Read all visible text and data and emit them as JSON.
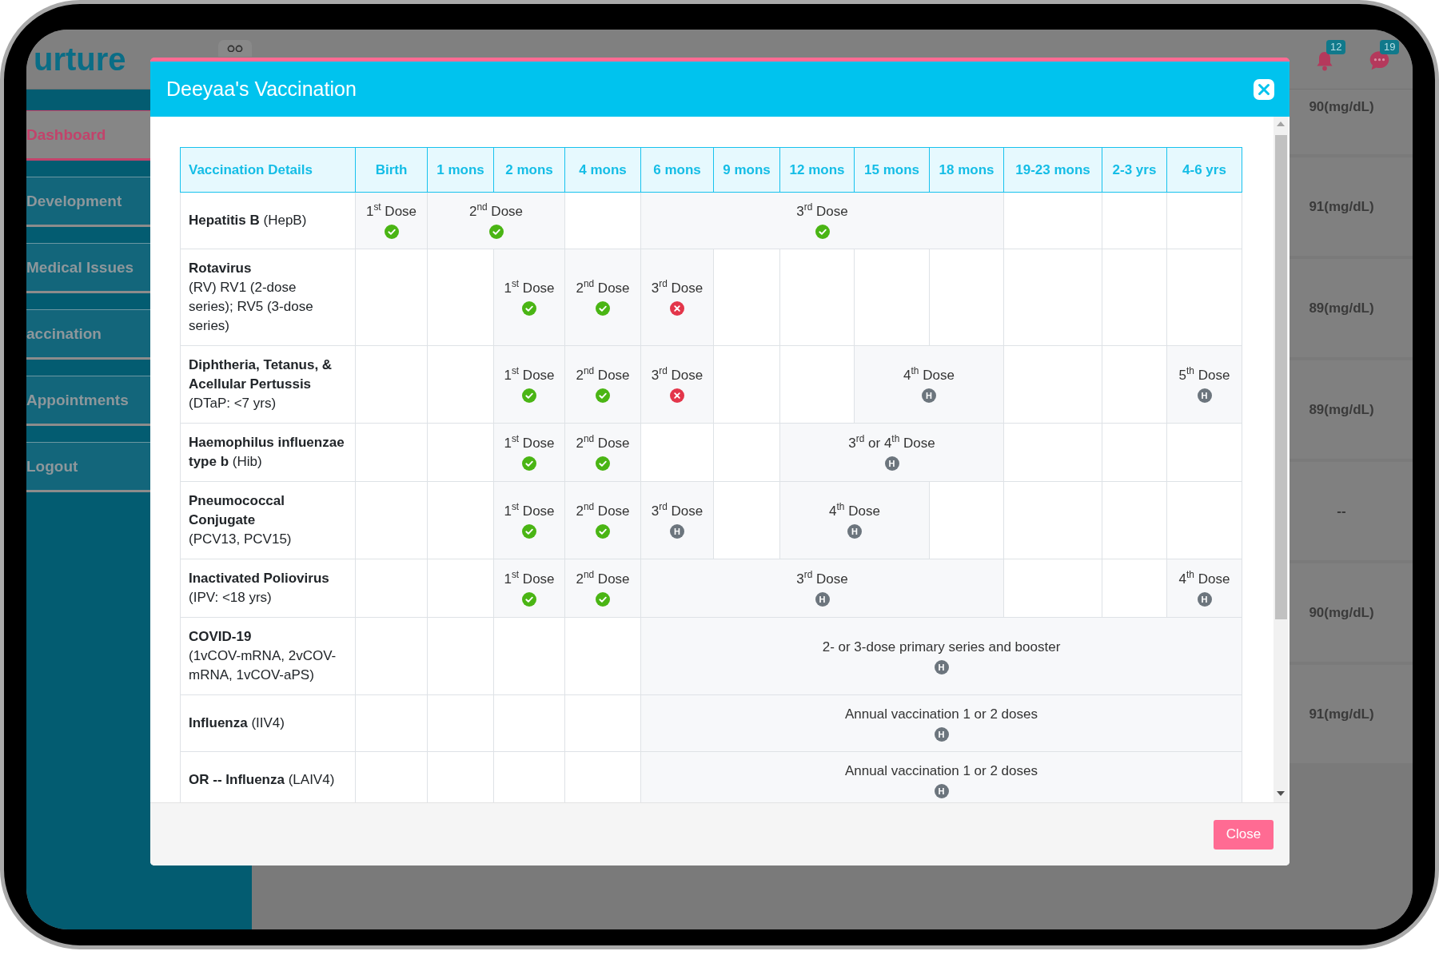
{
  "app": {
    "logo": "urture",
    "notifications": {
      "count": "12"
    },
    "messages": {
      "count": "19"
    },
    "sidebar": {
      "items": [
        {
          "label": "Dashboard",
          "selected": true
        },
        {
          "label": "Development",
          "selected": false
        },
        {
          "label": "Medical Issues",
          "selected": false
        },
        {
          "label": "accination",
          "selected": false
        },
        {
          "label": "Appointments",
          "selected": false
        },
        {
          "label": "Logout",
          "selected": false
        }
      ]
    },
    "readings": [
      "90(mg/dL)",
      "91(mg/dL)",
      "89(mg/dL)",
      "89(mg/dL)",
      "--",
      "90(mg/dL)",
      "91(mg/dL)"
    ]
  },
  "dialog": {
    "title": "Deeyaa's Vaccination",
    "table": {
      "row_heading": "Vaccination Details",
      "columns": [
        "Birth",
        "1 mons",
        "2 mons",
        "4 mons",
        "6 mons",
        "9 mons",
        "12 mons",
        "15 mons",
        "18 mons",
        "19-23 mons",
        "2-3 yrs",
        "4-6 yrs"
      ],
      "rows": [
        {
          "name": "Hepatitis B",
          "detail": "(HepB)",
          "kind": "inline",
          "cells": [
            {
              "kind": "given",
              "dose": "1$^{st}$ Dose"
            },
            {
              "kind": "given",
              "dose": "2$^{nd}$ Dose",
              "colspan": 2
            },
            {
              "kind": "empty"
            },
            {
              "kind": "given",
              "dose": "3$^{rd}$ Dose",
              "colspan": 5
            },
            {
              "kind": "empty"
            },
            {
              "kind": "empty"
            },
            {
              "kind": "empty"
            }
          ]
        },
        {
          "name": "Rotavirus",
          "detail": "(RV) RV1 (2-dose series); RV5 (3-dose series)",
          "kind": "stacked",
          "cells": [
            {
              "kind": "empty"
            },
            {
              "kind": "empty"
            },
            {
              "kind": "given",
              "dose": "1$^{st}$ Dose"
            },
            {
              "kind": "given",
              "dose": "2$^{nd}$ Dose"
            },
            {
              "kind": "missed",
              "dose": "3$^{rd}$ Dose"
            },
            {
              "kind": "empty"
            },
            {
              "kind": "empty"
            },
            {
              "kind": "empty"
            },
            {
              "kind": "empty"
            },
            {
              "kind": "empty"
            },
            {
              "kind": "empty"
            },
            {
              "kind": "empty"
            }
          ]
        },
        {
          "name": "Diphtheria, Tetanus, & Acellular Pertussis",
          "detail": "(DTaP: <7 yrs)",
          "kind": "stacked",
          "cells": [
            {
              "kind": "empty"
            },
            {
              "kind": "empty"
            },
            {
              "kind": "given",
              "dose": "1$^{st}$ Dose"
            },
            {
              "kind": "given",
              "dose": "2$^{nd}$ Dose"
            },
            {
              "kind": "missed",
              "dose": "3$^{rd}$ Dose"
            },
            {
              "kind": "empty"
            },
            {
              "kind": "empty"
            },
            {
              "kind": "pending",
              "dose": "4$^{th}$ Dose",
              "badge": "H",
              "colspan": 2
            },
            {
              "kind": "empty"
            },
            {
              "kind": "empty"
            },
            {
              "kind": "pending",
              "dose": "5$^{th}$ Dose",
              "badge": "H"
            }
          ]
        },
        {
          "name": "Haemophilus influenzae type b",
          "detail": "(Hib)",
          "kind": "inline",
          "cells": [
            {
              "kind": "empty"
            },
            {
              "kind": "empty"
            },
            {
              "kind": "given",
              "dose": "1$^{st}$ Dose"
            },
            {
              "kind": "given",
              "dose": "2$^{nd}$ Dose"
            },
            {
              "kind": "empty"
            },
            {
              "kind": "empty"
            },
            {
              "kind": "pending",
              "dose": "3$^{rd}$ or 4$^{th}$ Dose",
              "badge": "H",
              "colspan": 3
            },
            {
              "kind": "empty"
            },
            {
              "kind": "empty"
            },
            {
              "kind": "empty"
            }
          ]
        },
        {
          "name": "Pneumococcal Conjugate",
          "detail": "(PCV13, PCV15)",
          "kind": "stacked",
          "cells": [
            {
              "kind": "empty"
            },
            {
              "kind": "empty"
            },
            {
              "kind": "given",
              "dose": "1$^{st}$ Dose"
            },
            {
              "kind": "given",
              "dose": "2$^{nd}$ Dose"
            },
            {
              "kind": "pending",
              "dose": "3$^{rd}$ Dose",
              "badge": "H"
            },
            {
              "kind": "empty"
            },
            {
              "kind": "pending",
              "dose": "4$^{th}$ Dose",
              "badge": "H",
              "colspan": 2
            },
            {
              "kind": "empty"
            },
            {
              "kind": "empty"
            },
            {
              "kind": "empty"
            },
            {
              "kind": "empty"
            }
          ]
        },
        {
          "name": "Inactivated Poliovirus",
          "detail": "(IPV: <18 yrs)",
          "kind": "stacked",
          "cells": [
            {
              "kind": "empty"
            },
            {
              "kind": "empty"
            },
            {
              "kind": "given",
              "dose": "1$^{st}$ Dose"
            },
            {
              "kind": "given",
              "dose": "2$^{nd}$ Dose"
            },
            {
              "kind": "pending",
              "dose": "3$^{rd}$ Dose",
              "badge": "H",
              "colspan": 5
            },
            {
              "kind": "empty"
            },
            {
              "kind": "empty"
            },
            {
              "kind": "pending",
              "dose": "4$^{th}$ Dose",
              "badge": "H"
            }
          ]
        },
        {
          "name": "COVID-19",
          "detail": "(1vCOV-mRNA, 2vCOV-mRNA, 1vCOV-aPS)",
          "kind": "stacked",
          "cells": [
            {
              "kind": "empty"
            },
            {
              "kind": "empty"
            },
            {
              "kind": "empty"
            },
            {
              "kind": "empty"
            },
            {
              "kind": "pending",
              "dose": "2- or 3-dose primary series and booster",
              "badge": "H",
              "colspan": 8
            }
          ]
        },
        {
          "name": "Influenza",
          "detail": "(IIV4)",
          "kind": "inline",
          "cells": [
            {
              "kind": "empty"
            },
            {
              "kind": "empty"
            },
            {
              "kind": "empty"
            },
            {
              "kind": "empty"
            },
            {
              "kind": "pending",
              "dose": "Annual vaccination 1 or 2 doses",
              "badge": "H",
              "colspan": 8
            }
          ]
        },
        {
          "name": "OR -- Influenza",
          "detail": "(LAIV4)",
          "kind": "inline",
          "cells": [
            {
              "kind": "empty"
            },
            {
              "kind": "empty"
            },
            {
              "kind": "empty"
            },
            {
              "kind": "empty"
            },
            {
              "kind": "pending",
              "dose": "Annual vaccination 1 or 2 doses",
              "badge": "H",
              "colspan": 8
            }
          ]
        }
      ]
    },
    "close_button": "Close"
  }
}
